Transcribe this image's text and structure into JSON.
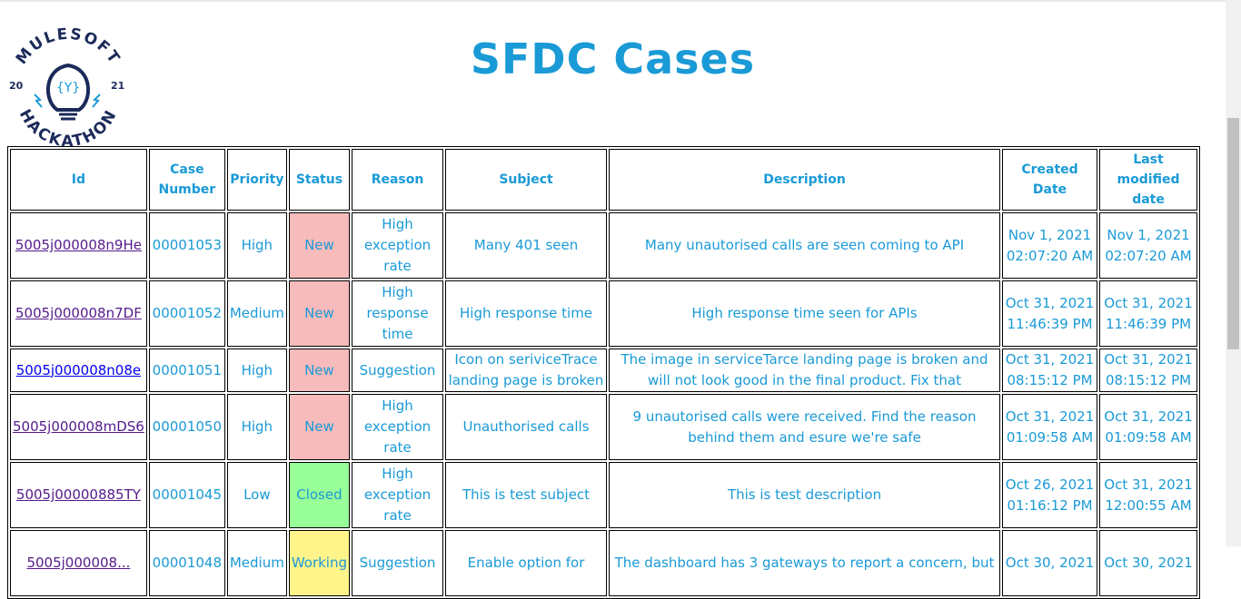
{
  "page": {
    "title": "SFDC Cases",
    "logo_text": "MULESOFT HACKATHON 2021"
  },
  "colors": {
    "text": "#1a9ad6",
    "new": "#f8bbbb",
    "closed": "#99ff99",
    "working": "#fff48a"
  },
  "table": {
    "headers": [
      "Id",
      "Case Number",
      "Priority",
      "Status",
      "Reason",
      "Subject",
      "Description",
      "Created Date",
      "Last modified date"
    ],
    "rows": [
      {
        "id": "5005j000008n9He",
        "case": "00001053",
        "priority": "High",
        "status": "New",
        "reason": "High exception rate",
        "subject": "Many 401 seen",
        "description": "Many unautorised calls are seen coming to API",
        "created": "Nov 1, 2021 02:07:20 AM",
        "modified": "Nov 1, 2021 02:07:20 AM"
      },
      {
        "id": "5005j000008n7DF",
        "case": "00001052",
        "priority": "Medium",
        "status": "New",
        "reason": "High response time",
        "subject": "High response time",
        "description": "High response time seen for APIs",
        "created": "Oct 31, 2021 11:46:39 PM",
        "modified": "Oct 31, 2021 11:46:39 PM"
      },
      {
        "id": "5005j000008n08e",
        "case": "00001051",
        "priority": "High",
        "status": "New",
        "reason": "Suggestion",
        "subject": "Icon on seriviceTrace landing page is broken",
        "description": "The image in serviceTarce landing page is broken and will not look good in the final product. Fix that",
        "created": "Oct 31, 2021 08:15:12 PM",
        "modified": "Oct 31, 2021 08:15:12 PM"
      },
      {
        "id": "5005j000008mDS6",
        "case": "00001050",
        "priority": "High",
        "status": "New",
        "reason": "High exception rate",
        "subject": "Unauthorised calls",
        "description": "9 unautorised calls were received. Find the reason behind them and esure we're safe",
        "created": "Oct 31, 2021 01:09:58 AM",
        "modified": "Oct 31, 2021 01:09:58 AM"
      },
      {
        "id": "5005j00000885TY",
        "case": "00001045",
        "priority": "Low",
        "status": "Closed",
        "reason": "High exception rate",
        "subject": "This is test subject",
        "description": "This is test description",
        "created": "Oct 26, 2021 01:16:12 PM",
        "modified": "Oct 31, 2021 12:00:55 AM"
      },
      {
        "id": "5005j000008...",
        "case": "00001048",
        "priority": "Medium",
        "status": "Working",
        "reason": "Suggestion",
        "subject": "Enable option for",
        "description": "The dashboard has 3 gateways to report a concern, but",
        "created": "Oct 30, 2021",
        "modified": "Oct 30, 2021"
      }
    ]
  }
}
